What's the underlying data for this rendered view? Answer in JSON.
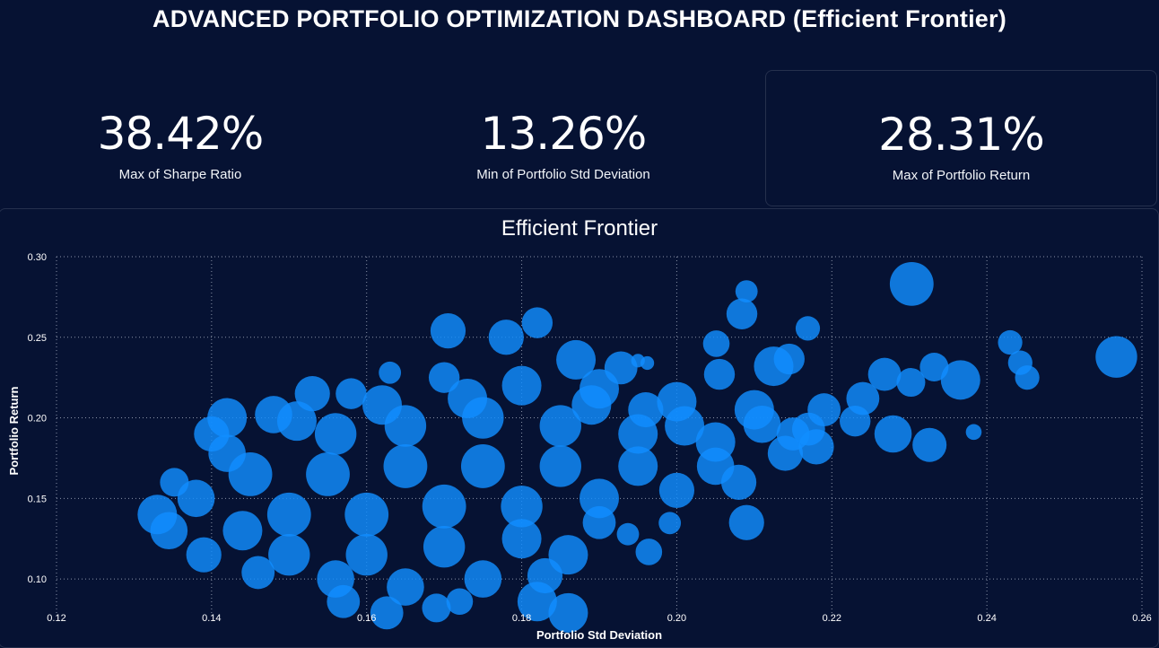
{
  "header": {
    "title": "ADVANCED PORTFOLIO OPTIMIZATION DASHBOARD (Efficient Frontier)"
  },
  "cards": [
    {
      "value": "38.42%",
      "label": "Max of Sharpe Ratio"
    },
    {
      "value": "13.26%",
      "label": "Min of Portfolio Std Deviation"
    },
    {
      "value": "28.31%",
      "label": "Max of Portfolio Return"
    }
  ],
  "colors": {
    "background": "#061233",
    "bubble": "#118DFF",
    "grid": "#8a93a8",
    "border": "#25304d"
  },
  "chart_data": {
    "type": "scatter",
    "title": "Efficient Frontier",
    "xlabel": "Portfolio Std Deviation",
    "ylabel": "Portfolio Return",
    "xlim": [
      0.12,
      0.26
    ],
    "ylim": [
      0.075,
      0.3
    ],
    "xticks": [
      "0.12",
      "0.14",
      "0.16",
      "0.18",
      "0.20",
      "0.22",
      "0.24",
      "0.26"
    ],
    "yticks": [
      "0.10",
      "0.15",
      "0.20",
      "0.25",
      "0.30"
    ],
    "grid": true,
    "bubble_size_encodes": "Sharpe Ratio",
    "series": [
      {
        "points": [
          {
            "x": 0.2303,
            "y": 0.2831,
            "s": 0.34
          },
          {
            "x": 0.2567,
            "y": 0.2378,
            "s": 0.32
          },
          {
            "x": 0.209,
            "y": 0.2785,
            "s": 0.14
          },
          {
            "x": 0.2084,
            "y": 0.2645,
            "s": 0.22
          },
          {
            "x": 0.2169,
            "y": 0.2555,
            "s": 0.16
          },
          {
            "x": 0.2051,
            "y": 0.246,
            "s": 0.18
          },
          {
            "x": 0.2125,
            "y": 0.232,
            "s": 0.3
          },
          {
            "x": 0.2145,
            "y": 0.2365,
            "s": 0.22
          },
          {
            "x": 0.243,
            "y": 0.2468,
            "s": 0.16
          },
          {
            "x": 0.2443,
            "y": 0.2342,
            "s": 0.16
          },
          {
            "x": 0.2452,
            "y": 0.225,
            "s": 0.16
          },
          {
            "x": 0.2366,
            "y": 0.2235,
            "s": 0.3
          },
          {
            "x": 0.2332,
            "y": 0.2315,
            "s": 0.2
          },
          {
            "x": 0.2302,
            "y": 0.222,
            "s": 0.2
          },
          {
            "x": 0.2268,
            "y": 0.227,
            "s": 0.24
          },
          {
            "x": 0.2279,
            "y": 0.19,
            "s": 0.28
          },
          {
            "x": 0.2326,
            "y": 0.1832,
            "s": 0.25
          },
          {
            "x": 0.2383,
            "y": 0.1912,
            "s": 0.08
          },
          {
            "x": 0.218,
            "y": 0.182,
            "s": 0.26
          },
          {
            "x": 0.209,
            "y": 0.135,
            "s": 0.26
          },
          {
            "x": 0.1991,
            "y": 0.1347,
            "s": 0.14
          },
          {
            "x": 0.1964,
            "y": 0.1168,
            "s": 0.18
          },
          {
            "x": 0.1937,
            "y": 0.1278,
            "s": 0.14
          },
          {
            "x": 0.186,
            "y": 0.079,
            "s": 0.3
          },
          {
            "x": 0.182,
            "y": 0.086,
            "s": 0.3
          },
          {
            "x": 0.172,
            "y": 0.086,
            "s": 0.18
          },
          {
            "x": 0.169,
            "y": 0.082,
            "s": 0.2
          },
          {
            "x": 0.1626,
            "y": 0.079,
            "s": 0.24
          },
          {
            "x": 0.157,
            "y": 0.086,
            "s": 0.24
          },
          {
            "x": 0.1705,
            "y": 0.254,
            "s": 0.26
          },
          {
            "x": 0.182,
            "y": 0.259,
            "s": 0.22
          },
          {
            "x": 0.178,
            "y": 0.25,
            "s": 0.26
          },
          {
            "x": 0.2055,
            "y": 0.227,
            "s": 0.22
          },
          {
            "x": 0.1928,
            "y": 0.231,
            "s": 0.24
          },
          {
            "x": 0.187,
            "y": 0.236,
            "s": 0.3
          },
          {
            "x": 0.195,
            "y": 0.2355,
            "s": 0.06
          },
          {
            "x": 0.1962,
            "y": 0.234,
            "s": 0.06
          },
          {
            "x": 0.133,
            "y": 0.14,
            "s": 0.3
          },
          {
            "x": 0.1345,
            "y": 0.13,
            "s": 0.28
          },
          {
            "x": 0.1352,
            "y": 0.16,
            "s": 0.2
          },
          {
            "x": 0.139,
            "y": 0.115,
            "s": 0.26
          },
          {
            "x": 0.146,
            "y": 0.104,
            "s": 0.24
          },
          {
            "x": 0.14,
            "y": 0.19,
            "s": 0.26
          },
          {
            "x": 0.142,
            "y": 0.2,
            "s": 0.3
          },
          {
            "x": 0.148,
            "y": 0.202,
            "s": 0.28
          },
          {
            "x": 0.153,
            "y": 0.215,
            "s": 0.26
          },
          {
            "x": 0.158,
            "y": 0.215,
            "s": 0.22
          },
          {
            "x": 0.163,
            "y": 0.228,
            "s": 0.14
          },
          {
            "x": 0.17,
            "y": 0.225,
            "s": 0.22
          },
          {
            "x": 0.18,
            "y": 0.22,
            "s": 0.3
          },
          {
            "x": 0.19,
            "y": 0.218,
            "s": 0.3
          },
          {
            "x": 0.2,
            "y": 0.21,
            "s": 0.3
          },
          {
            "x": 0.21,
            "y": 0.205,
            "s": 0.3
          },
          {
            "x": 0.219,
            "y": 0.205,
            "s": 0.24
          },
          {
            "x": 0.224,
            "y": 0.212,
            "s": 0.24
          },
          {
            "x": 0.156,
            "y": 0.19,
            "s": 0.32
          },
          {
            "x": 0.165,
            "y": 0.195,
            "s": 0.32
          },
          {
            "x": 0.175,
            "y": 0.2,
            "s": 0.32
          },
          {
            "x": 0.185,
            "y": 0.195,
            "s": 0.32
          },
          {
            "x": 0.195,
            "y": 0.19,
            "s": 0.3
          },
          {
            "x": 0.205,
            "y": 0.185,
            "s": 0.3
          },
          {
            "x": 0.215,
            "y": 0.19,
            "s": 0.24
          },
          {
            "x": 0.145,
            "y": 0.165,
            "s": 0.34
          },
          {
            "x": 0.155,
            "y": 0.165,
            "s": 0.34
          },
          {
            "x": 0.165,
            "y": 0.17,
            "s": 0.34
          },
          {
            "x": 0.175,
            "y": 0.17,
            "s": 0.34
          },
          {
            "x": 0.185,
            "y": 0.17,
            "s": 0.32
          },
          {
            "x": 0.195,
            "y": 0.17,
            "s": 0.3
          },
          {
            "x": 0.205,
            "y": 0.17,
            "s": 0.28
          },
          {
            "x": 0.214,
            "y": 0.178,
            "s": 0.26
          },
          {
            "x": 0.15,
            "y": 0.14,
            "s": 0.34
          },
          {
            "x": 0.16,
            "y": 0.14,
            "s": 0.34
          },
          {
            "x": 0.17,
            "y": 0.145,
            "s": 0.34
          },
          {
            "x": 0.18,
            "y": 0.145,
            "s": 0.32
          },
          {
            "x": 0.19,
            "y": 0.15,
            "s": 0.3
          },
          {
            "x": 0.2,
            "y": 0.155,
            "s": 0.26
          },
          {
            "x": 0.208,
            "y": 0.16,
            "s": 0.26
          },
          {
            "x": 0.15,
            "y": 0.115,
            "s": 0.32
          },
          {
            "x": 0.16,
            "y": 0.115,
            "s": 0.32
          },
          {
            "x": 0.17,
            "y": 0.12,
            "s": 0.32
          },
          {
            "x": 0.18,
            "y": 0.125,
            "s": 0.3
          },
          {
            "x": 0.186,
            "y": 0.115,
            "s": 0.3
          },
          {
            "x": 0.19,
            "y": 0.135,
            "s": 0.24
          },
          {
            "x": 0.156,
            "y": 0.1,
            "s": 0.28
          },
          {
            "x": 0.165,
            "y": 0.095,
            "s": 0.28
          },
          {
            "x": 0.175,
            "y": 0.1,
            "s": 0.28
          },
          {
            "x": 0.183,
            "y": 0.102,
            "s": 0.26
          },
          {
            "x": 0.144,
            "y": 0.13,
            "s": 0.3
          },
          {
            "x": 0.138,
            "y": 0.15,
            "s": 0.28
          },
          {
            "x": 0.142,
            "y": 0.178,
            "s": 0.28
          },
          {
            "x": 0.196,
            "y": 0.205,
            "s": 0.26
          },
          {
            "x": 0.211,
            "y": 0.196,
            "s": 0.28
          },
          {
            "x": 0.217,
            "y": 0.193,
            "s": 0.24
          },
          {
            "x": 0.223,
            "y": 0.198,
            "s": 0.22
          },
          {
            "x": 0.201,
            "y": 0.195,
            "s": 0.3
          },
          {
            "x": 0.189,
            "y": 0.208,
            "s": 0.3
          },
          {
            "x": 0.173,
            "y": 0.212,
            "s": 0.3
          },
          {
            "x": 0.162,
            "y": 0.208,
            "s": 0.3
          },
          {
            "x": 0.151,
            "y": 0.198,
            "s": 0.3
          }
        ]
      }
    ]
  }
}
